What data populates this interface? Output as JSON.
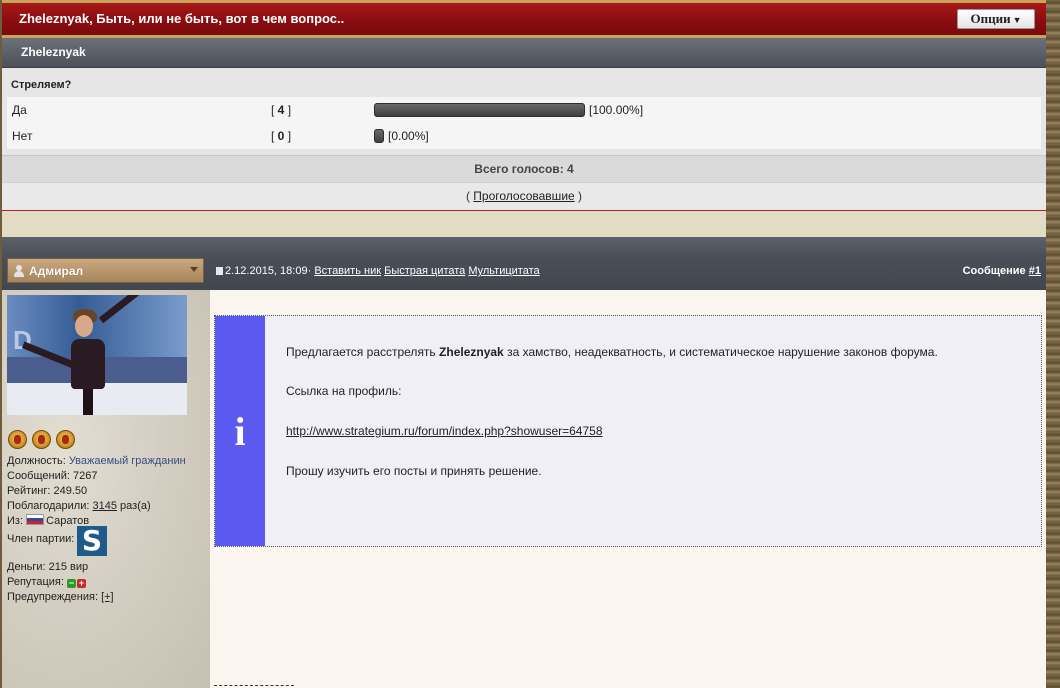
{
  "topic": {
    "title": "Zheleznyak, Быть, или не быть, вот в чем вопрос..",
    "options_label": "Опции"
  },
  "section": {
    "label": "Zheleznyak"
  },
  "poll": {
    "question": "Стреляем?",
    "options": [
      {
        "label": "Да",
        "count": "4",
        "percent": "[100.00%]",
        "fraction": 1.0
      },
      {
        "label": "Нет",
        "count": "0",
        "percent": "[0.00%]",
        "fraction": 0.0
      }
    ],
    "total": "Всего голосов: 4",
    "voters_link": "Проголосовавшие"
  },
  "post": {
    "author": "Адмирал",
    "date": "2.12.2015, 18:09",
    "separator": "·",
    "actions": [
      "Вставить ник",
      "Быстрая цитата",
      "Мультицитата"
    ],
    "number_prefix": "Сообщение",
    "number": "#1",
    "body": {
      "line1_pre": "Предлагается расстрелять",
      "line1_name": "Zheleznyak",
      "line1_post": "за хамство, неадекватность, и систематическое нарушение законов форума.",
      "line2": "Ссылка на профиль:",
      "link": "http://www.strategium.ru/forum/index.php?showuser=64758",
      "line4": "Прошу изучить его посты и принять решение."
    }
  },
  "user": {
    "position_label": "Должность:",
    "position_value": "Уважаемый гражданин",
    "posts": "Сообщений: 7267",
    "rating": "Рейтинг: 249.50",
    "thanks_label": "Поблагодарили:",
    "thanks_count": "3145",
    "thanks_suffix": "раз(а)",
    "from_label": "Из:",
    "from_value": "Саратов",
    "party_label": "Член партии:",
    "party_letter": "S",
    "money": "Деньги: 215 вир",
    "reputation_label": "Репутация:",
    "rep_minus": "−",
    "rep_plus": "+",
    "warnings_label": "Предупреждения:",
    "warnings_link": "[+]",
    "avatar_logo": "D"
  }
}
